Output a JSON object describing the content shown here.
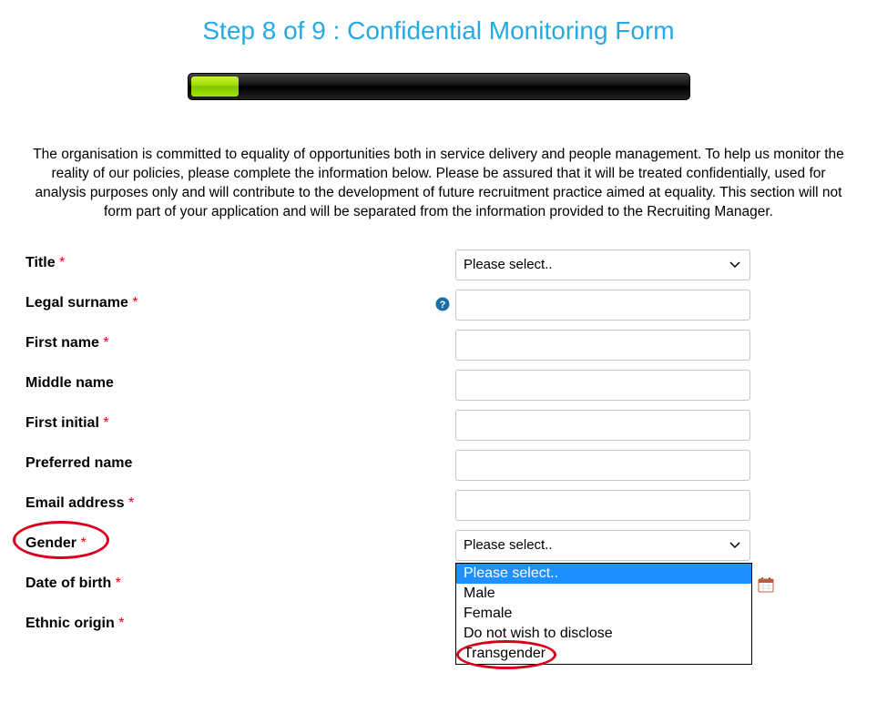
{
  "page_title": "Step 8 of 9 : Confidential Monitoring Form",
  "intro_text": "The organisation is committed to equality of opportunities both in service delivery and people management. To help us monitor the reality of our policies, please complete the information below. Please be assured that it will be treated confidentially, used for analysis purposes only and will contribute to the development of future recruitment practice aimed at equality. This section will not form part of your application and will be separated from the information provided to the Recruiting Manager.",
  "progress": {
    "step": 8,
    "total": 9
  },
  "fields": {
    "title": {
      "label": "Title",
      "required": true,
      "selected": "Please select.."
    },
    "legal_surname": {
      "label": "Legal surname",
      "required": true
    },
    "first_name": {
      "label": "First name",
      "required": true
    },
    "middle_name": {
      "label": "Middle name",
      "required": false
    },
    "first_initial": {
      "label": "First initial",
      "required": true
    },
    "preferred_name": {
      "label": "Preferred name",
      "required": false
    },
    "email": {
      "label": "Email address",
      "required": true
    },
    "gender": {
      "label": "Gender",
      "required": true,
      "selected": "Please select..",
      "options": [
        "Please select..",
        "Male",
        "Female",
        "Do not wish to disclose",
        "Transgender"
      ]
    },
    "dob": {
      "label": "Date of birth",
      "required": true
    },
    "ethnic": {
      "label": "Ethnic origin",
      "required": true
    }
  },
  "required_marker": "*",
  "annotations": {
    "gender_label_circle": true,
    "transgender_option_circle": true
  }
}
